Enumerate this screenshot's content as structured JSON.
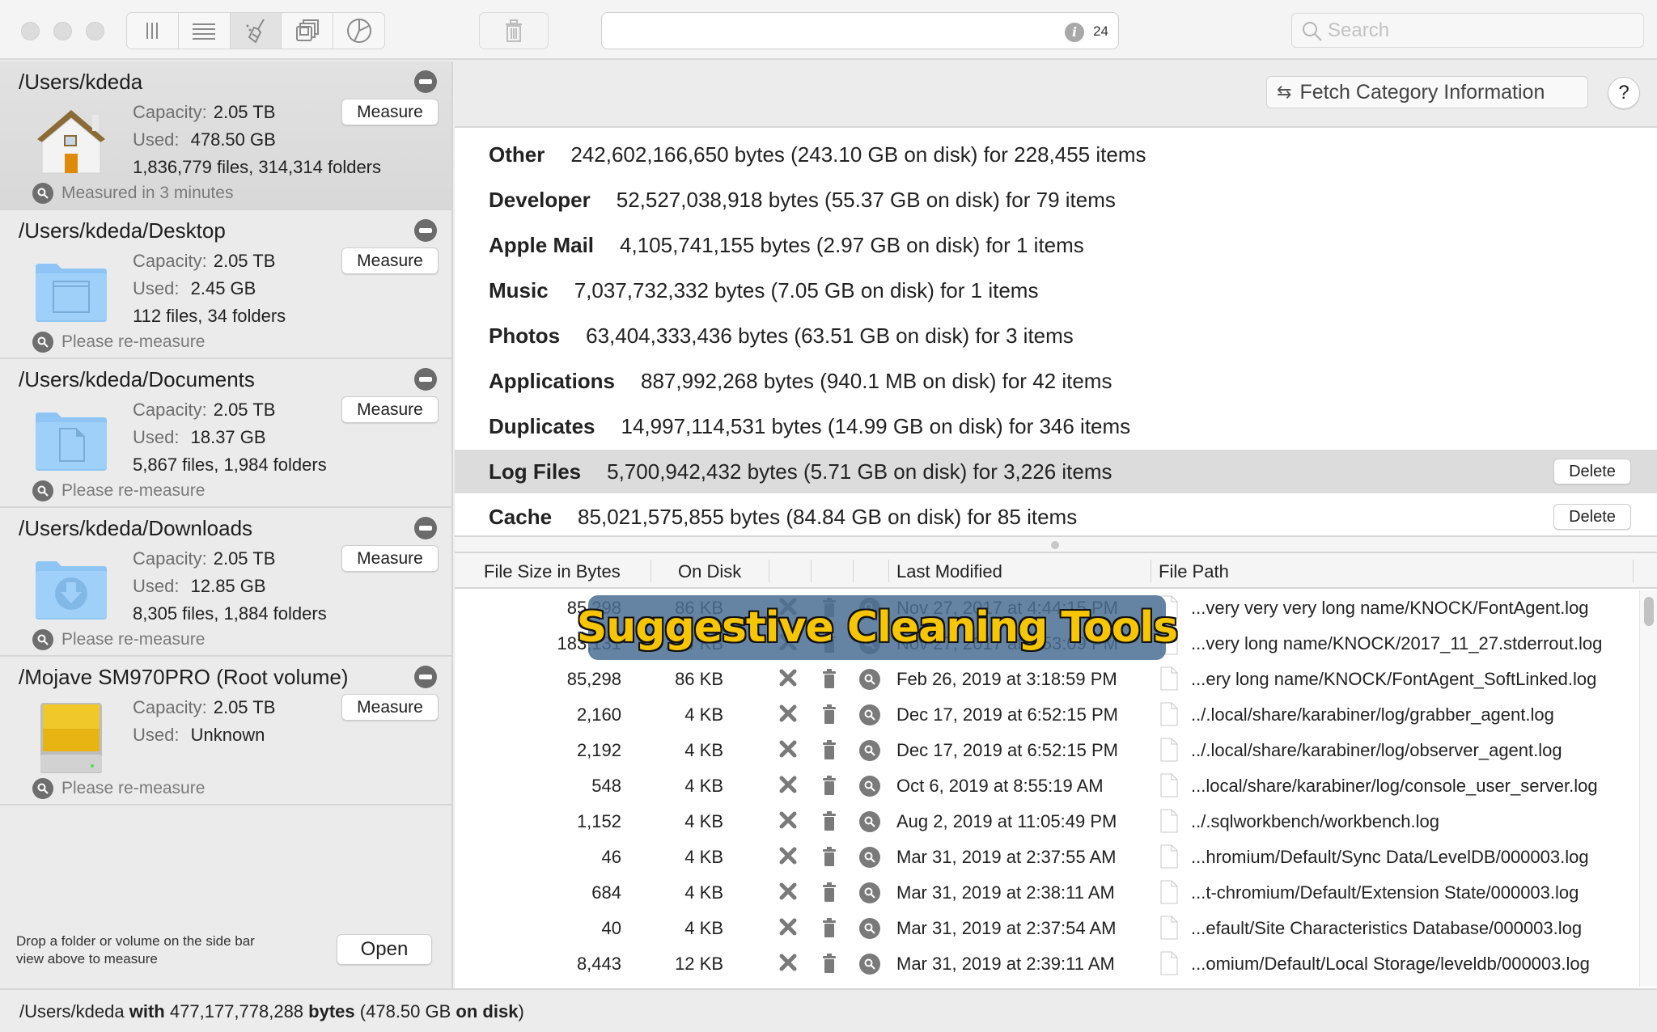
{
  "toolbar": {
    "view_buttons": [
      {
        "name": "column-view",
        "icon": "columns-icon",
        "active": false
      },
      {
        "name": "list-view",
        "icon": "list-icon",
        "active": false
      },
      {
        "name": "cleaning-view",
        "icon": "broom-icon",
        "active": true
      },
      {
        "name": "windows-view",
        "icon": "stacked-windows-icon",
        "active": false
      },
      {
        "name": "pie-view",
        "icon": "pie-chart-icon",
        "active": false
      }
    ],
    "trash_icon": "trash-icon",
    "info_count": "24",
    "info_glyph": "i",
    "search_placeholder": "Search",
    "search_value": ""
  },
  "sidebar": {
    "volumes": [
      {
        "path": "/Users/kdeda",
        "icon": "home-icon",
        "capacity_label": "Capacity:",
        "capacity": "2.05 TB",
        "used_label": "Used:",
        "used": "478.50 GB",
        "counts": "1,836,779 files, 314,314 folders",
        "status": "Measured in 3 minutes",
        "measure_label": "Measure",
        "selected": true
      },
      {
        "path": "/Users/kdeda/Desktop",
        "icon": "desktop-folder-icon",
        "capacity_label": "Capacity:",
        "capacity": "2.05 TB",
        "used_label": "Used:",
        "used": "2.45 GB",
        "counts": "112 files, 34 folders",
        "status": "Please re-measure",
        "measure_label": "Measure",
        "selected": false
      },
      {
        "path": "/Users/kdeda/Documents",
        "icon": "documents-folder-icon",
        "capacity_label": "Capacity:",
        "capacity": "2.05 TB",
        "used_label": "Used:",
        "used": "18.37 GB",
        "counts": "5,867 files, 1,984 folders",
        "status": "Please re-measure",
        "measure_label": "Measure",
        "selected": false
      },
      {
        "path": "/Users/kdeda/Downloads",
        "icon": "downloads-folder-icon",
        "capacity_label": "Capacity:",
        "capacity": "2.05 TB",
        "used_label": "Used:",
        "used": "12.85 GB",
        "counts": "8,305 files, 1,884 folders",
        "status": "Please re-measure",
        "measure_label": "Measure",
        "selected": false
      },
      {
        "path": "/Mojave SM970PRO (Root volume)",
        "icon": "hard-drive-icon",
        "capacity_label": "Capacity:",
        "capacity": "2.05 TB",
        "used_label": "Used:",
        "used": "Unknown",
        "counts": "",
        "status": "Please re-measure",
        "measure_label": "Measure",
        "selected": false
      }
    ],
    "drop_hint_line1": "Drop a folder or volume on the side bar",
    "drop_hint_line2": "view above to measure",
    "open_label": "Open"
  },
  "header": {
    "fetch_label": "Fetch Category Information",
    "help_label": "?"
  },
  "categories": [
    {
      "name": "Other",
      "detail": "242,602,166,650 bytes (243.10 GB on disk) for 228,455 items",
      "selected": false,
      "delete_label": ""
    },
    {
      "name": "Developer",
      "detail": "52,527,038,918 bytes (55.37 GB on disk) for 79 items",
      "selected": false,
      "delete_label": ""
    },
    {
      "name": "Apple Mail",
      "detail": "4,105,741,155 bytes (2.97 GB on disk) for 1 items",
      "selected": false,
      "delete_label": ""
    },
    {
      "name": "Music",
      "detail": "7,037,732,332 bytes (7.05 GB on disk) for 1 items",
      "selected": false,
      "delete_label": ""
    },
    {
      "name": "Photos",
      "detail": "63,404,333,436 bytes (63.51 GB on disk) for 3 items",
      "selected": false,
      "delete_label": ""
    },
    {
      "name": "Applications",
      "detail": "887,992,268 bytes (940.1 MB on disk) for 42 items",
      "selected": false,
      "delete_label": ""
    },
    {
      "name": "Duplicates",
      "detail": "14,997,114,531 bytes (14.99 GB on disk) for 346 items",
      "selected": false,
      "delete_label": ""
    },
    {
      "name": "Log Files",
      "detail": "5,700,942,432 bytes (5.71 GB on disk) for 3,226 items",
      "selected": true,
      "delete_label": "Delete"
    },
    {
      "name": "Cache",
      "detail": "85,021,575,855 bytes (84.84 GB on disk) for 85 items",
      "selected": false,
      "delete_label": "Delete"
    }
  ],
  "table": {
    "columns": [
      "File Size in Bytes",
      "On Disk",
      "",
      "",
      "",
      "Last Modified",
      "File Path"
    ],
    "rows": [
      {
        "size": "85,298",
        "disk": "86 KB",
        "modified": "Nov 27, 2017 at 4:44:15 PM",
        "path": "...very very very long name/KNOCK/FontAgent.log"
      },
      {
        "size": "183,131",
        "disk": "184 KB",
        "modified": "Nov 27, 2017 at 3:53:09 PM",
        "path": "...very long name/KNOCK/2017_11_27.stderrout.log"
      },
      {
        "size": "85,298",
        "disk": "86 KB",
        "modified": "Feb 26, 2019 at 3:18:59 PM",
        "path": "...ery long name/KNOCK/FontAgent_SoftLinked.log"
      },
      {
        "size": "2,160",
        "disk": "4 KB",
        "modified": "Dec 17, 2019 at 6:52:15 PM",
        "path": "../.local/share/karabiner/log/grabber_agent.log"
      },
      {
        "size": "2,192",
        "disk": "4 KB",
        "modified": "Dec 17, 2019 at 6:52:15 PM",
        "path": "../.local/share/karabiner/log/observer_agent.log"
      },
      {
        "size": "548",
        "disk": "4 KB",
        "modified": "Oct 6, 2019 at 8:55:19 AM",
        "path": "...local/share/karabiner/log/console_user_server.log"
      },
      {
        "size": "1,152",
        "disk": "4 KB",
        "modified": "Aug 2, 2019 at 11:05:49 PM",
        "path": "../.sqlworkbench/workbench.log"
      },
      {
        "size": "46",
        "disk": "4 KB",
        "modified": "Mar 31, 2019 at 2:37:55 AM",
        "path": "...hromium/Default/Sync Data/LevelDB/000003.log"
      },
      {
        "size": "684",
        "disk": "4 KB",
        "modified": "Mar 31, 2019 at 2:38:11 AM",
        "path": "...t-chromium/Default/Extension State/000003.log"
      },
      {
        "size": "40",
        "disk": "4 KB",
        "modified": "Mar 31, 2019 at 2:37:54 AM",
        "path": "...efault/Site Characteristics Database/000003.log"
      },
      {
        "size": "8,443",
        "disk": "12 KB",
        "modified": "Mar 31, 2019 at 2:39:11 AM",
        "path": "...omium/Default/Local Storage/leveldb/000003.log"
      }
    ]
  },
  "overlay": {
    "caption": "Suggestive Cleaning Tools"
  },
  "statusbar": {
    "path": "/Users/kdeda",
    "with": "with",
    "bytes_value": "477,177,778,288",
    "bytes_word": "bytes",
    "disk_value": "(478.50 GB",
    "disk_word": "on disk",
    "close_paren": ")"
  },
  "colors": {
    "accent_folder": "#8ec5f5",
    "drive_yellow": "#f0c419",
    "overlay_bg": "#4a6e94",
    "overlay_text": "#f7c600"
  }
}
